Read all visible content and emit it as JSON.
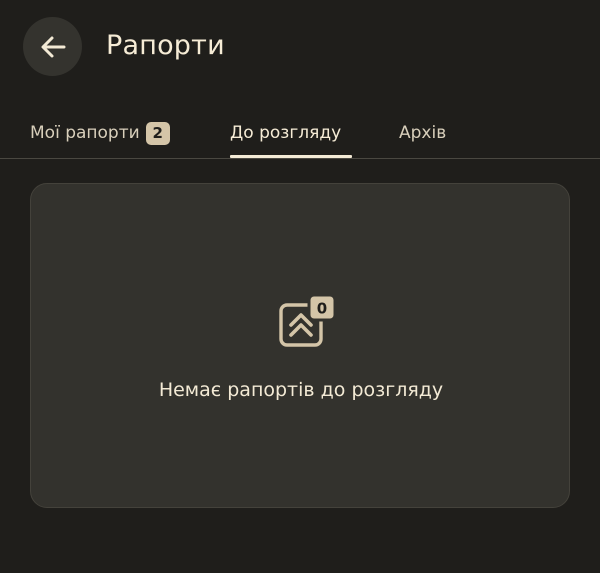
{
  "header": {
    "back_icon": "arrow-left-icon",
    "title": "Рапорти"
  },
  "tabs": [
    {
      "label": "Мої рапорти",
      "badge": "2",
      "active": false
    },
    {
      "label": "До розгляду",
      "active": true
    },
    {
      "label": "Архів",
      "active": false
    }
  ],
  "empty_state": {
    "icon": "rank-chevrons-icon",
    "icon_badge": "0",
    "message": "Немає рапортів до розгляду"
  },
  "colors": {
    "background": "#1f1e1b",
    "card": "#33322d",
    "accent": "#d4c5a8",
    "text": "#f3ead5"
  }
}
